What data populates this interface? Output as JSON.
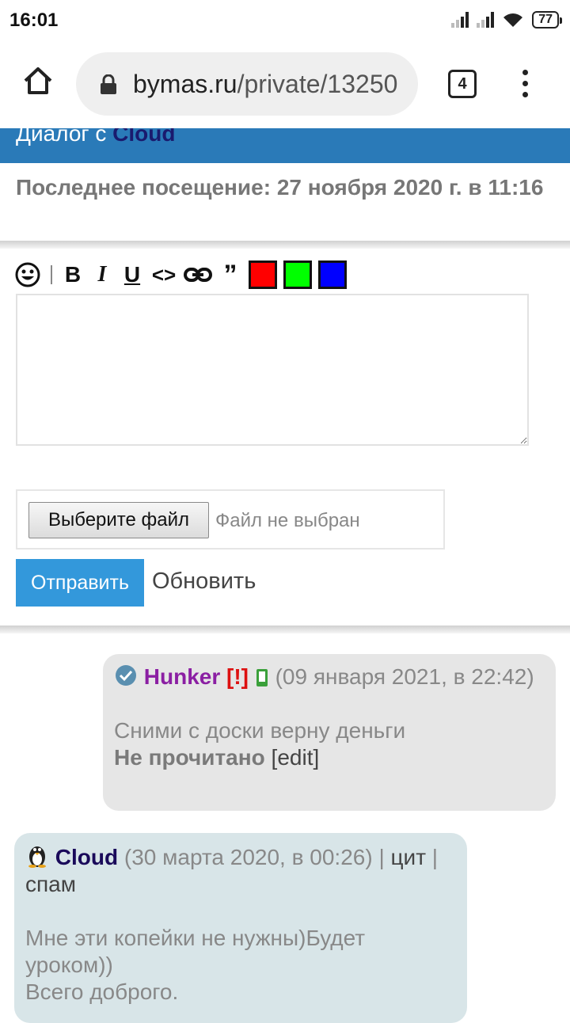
{
  "status_bar": {
    "time": "16:01",
    "battery": "77"
  },
  "browser": {
    "url_domain": "bymas.ru",
    "url_path": "/private/13250",
    "tab_count": "4"
  },
  "dialog": {
    "title_prefix": "Диалог с ",
    "partner": "Cloud"
  },
  "last_visit": "Последнее посещение: 27 ноября 2020 г. в 11:16",
  "toolbar": {
    "icons": [
      "smile-icon",
      "bold-icon",
      "italic-icon",
      "underline-icon",
      "code-icon",
      "link-icon",
      "quote-icon"
    ],
    "colors": [
      "#ff0000",
      "#00ff00",
      "#0000ff"
    ]
  },
  "editor": {
    "value": ""
  },
  "file": {
    "button_label": "Выберите файл",
    "status": "Файл не выбран"
  },
  "actions": {
    "send_label": "Отправить",
    "refresh_label": "Обновить"
  },
  "messages": [
    {
      "author": "Hunker",
      "flag": "[!]",
      "date": "(09 января 2021, в 22:42)",
      "text": "Сними с доски верну деньги",
      "status": "Не прочитано",
      "edit_label": "[edit]"
    },
    {
      "author": "Cloud",
      "date": "(30 марта 2020, в 00:26)",
      "sep1": " | ",
      "quote_label": "цит",
      "sep2": " | ",
      "spam_label": "спам",
      "text_line1": "Мне эти копейки не нужны)Будет уроком))",
      "text_line2": "Всего доброго."
    }
  ]
}
